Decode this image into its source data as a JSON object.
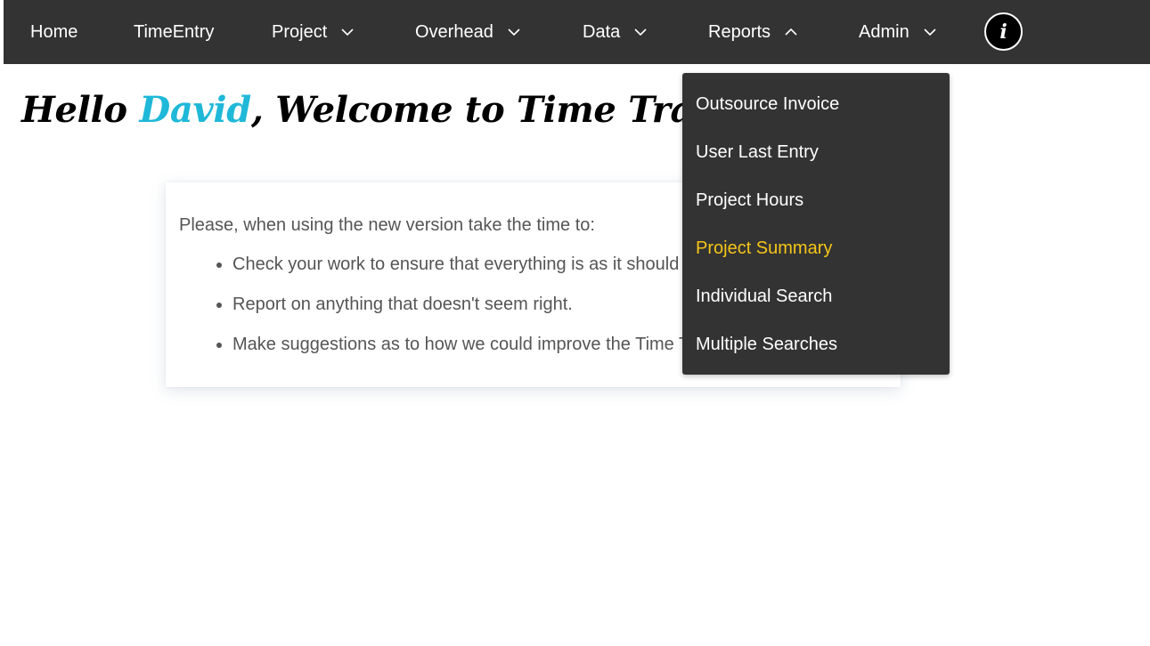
{
  "nav": {
    "items": [
      {
        "label": "Home"
      },
      {
        "label": "TimeEntry"
      },
      {
        "label": "Project"
      },
      {
        "label": "Overhead"
      },
      {
        "label": "Data"
      },
      {
        "label": "Reports"
      },
      {
        "label": "Admin"
      }
    ],
    "info_icon": "i"
  },
  "welcome": {
    "greeting": "Hello ",
    "user": "David",
    "rest": ", Welcome to Time Tracking"
  },
  "notice": {
    "intro": "Please, when using the new version take the time to:",
    "bullets": [
      "Check your work to ensure that everything is as it should be.",
      "Report on anything that doesn't seem right.",
      "Make suggestions as to how we could improve the Time Tracking system."
    ]
  },
  "reports_menu": {
    "items": [
      {
        "label": "Outsource Invoice"
      },
      {
        "label": "User Last Entry"
      },
      {
        "label": "Project Hours"
      },
      {
        "label": "Project Summary"
      },
      {
        "label": "Individual Search"
      },
      {
        "label": "Multiple Searches"
      }
    ]
  },
  "colors": {
    "navbar_bg": "#333333",
    "accent_user": "#1fb8d8",
    "menu_active": "#f5c518"
  }
}
